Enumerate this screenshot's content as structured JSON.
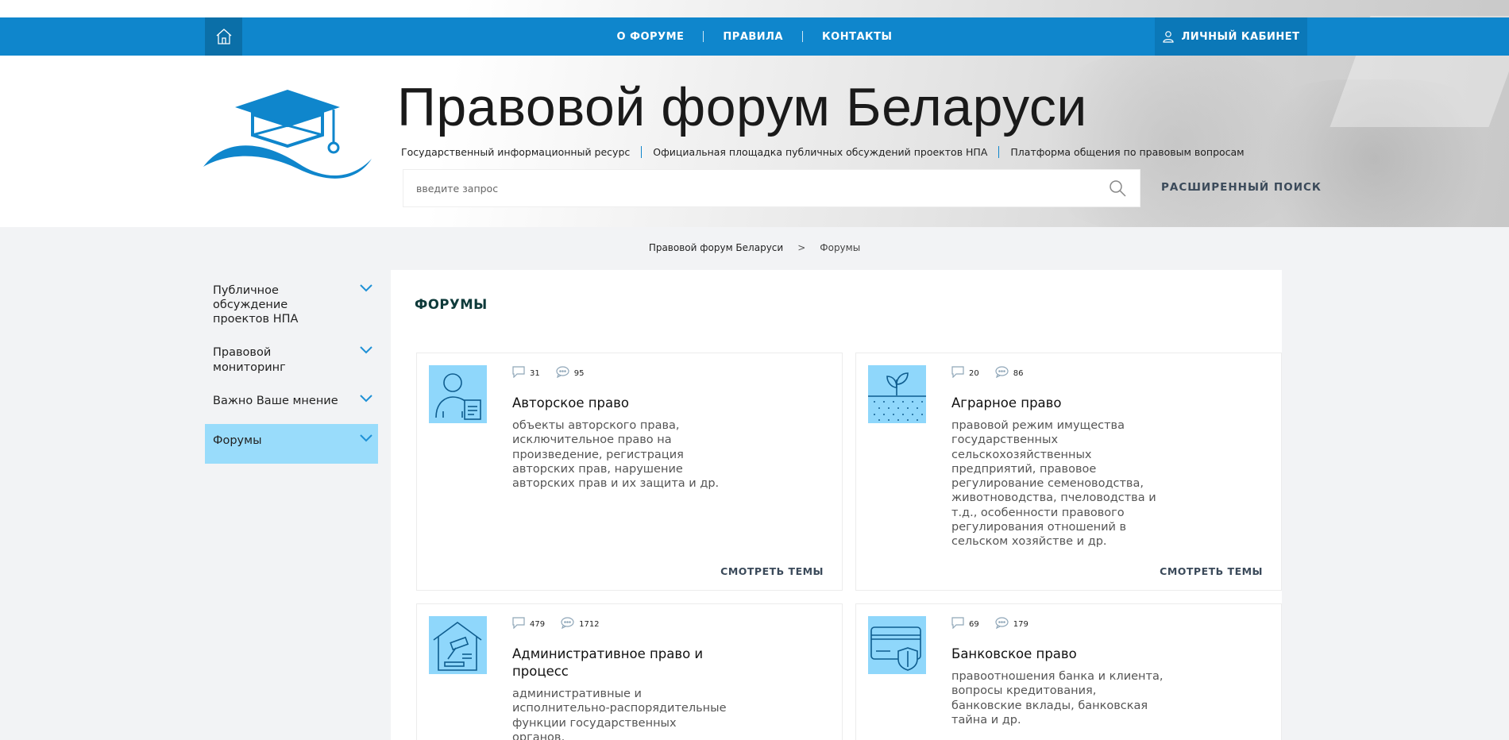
{
  "nav": {
    "links": [
      "О ФОРУМЕ",
      "ПРАВИЛА",
      "КОНТАКТЫ"
    ],
    "cabinet": "ЛИЧНЫЙ КАБИНЕТ"
  },
  "header": {
    "title": "Правовой форум Беларуси",
    "subtitles": [
      "Государственный информационный ресурс",
      "Официальная площадка публичных обсуждений проектов НПА",
      "Платформа общения по правовым вопросам"
    ]
  },
  "search": {
    "placeholder": "введите запрос",
    "advanced": "РАСШИРЕННЫЙ ПОИСК"
  },
  "breadcrumb": {
    "home": "Правовой форум Беларуси",
    "sep": ">",
    "current": "Форумы"
  },
  "sidebar": {
    "items": [
      {
        "label": "Публичное обсуждение проектов НПА"
      },
      {
        "label": "Правовой мониторинг"
      },
      {
        "label": "Важно Ваше мнение"
      },
      {
        "label": "Форумы",
        "active": true
      }
    ]
  },
  "main": {
    "heading": "ФОРУМЫ",
    "more_label": "СМОТРЕТЬ ТЕМЫ",
    "cards": [
      {
        "icon": "author-document-icon",
        "topics": "31",
        "posts": "95",
        "title": "Авторское право",
        "desc": "объекты авторского права, исключительное право на произведение, регистрация авторских прав, нарушение авторских прав и их защита и др."
      },
      {
        "icon": "plant-sprout-icon",
        "topics": "20",
        "posts": "86",
        "title": "Аграрное право",
        "desc": "правовой режим имущества государственных сельскохозяйственных предприятий, правовое регулирование семеноводства, животноводства, пчеловодства и т.д., особенности правового регулирования отношений в сельском хозяйстве и др."
      },
      {
        "icon": "courthouse-gavel-icon",
        "topics": "479",
        "posts": "1712",
        "title": "Административное право и процесс",
        "desc": "административные и исполнительно-распорядительные функции государственных органов,"
      },
      {
        "icon": "bank-card-shield-icon",
        "topics": "69",
        "posts": "179",
        "title": "Банковское право",
        "desc": "правоотношения банка и клиента, вопросы кредитования, банковские вклады, банковская тайна и др."
      }
    ]
  },
  "colors": {
    "brand": "#0f86cc",
    "active": "#99dcfb",
    "icon_bg": "#8fd7fb"
  }
}
